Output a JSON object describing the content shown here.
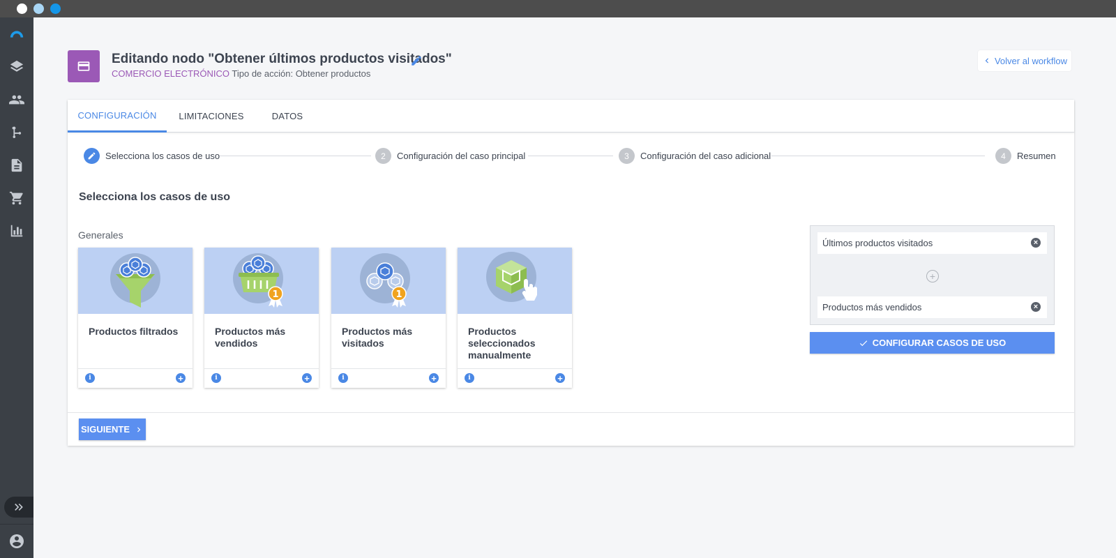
{
  "window": {
    "controls": [
      "close",
      "minimize",
      "maximize"
    ]
  },
  "sidebar": {
    "items": [
      {
        "icon": "logo-icon"
      },
      {
        "icon": "layers-icon"
      },
      {
        "icon": "people-icon"
      },
      {
        "icon": "workflow-icon"
      },
      {
        "icon": "document-icon"
      },
      {
        "icon": "cart-icon"
      },
      {
        "icon": "chart-icon"
      }
    ],
    "expand_icon": "double-chevron-right-icon",
    "avatar_icon": "account-circle-icon"
  },
  "header": {
    "title": "Editando nodo \"Obtener últimos productos visitados\"",
    "category": "COMERCIO ELECTRÓNICO",
    "action_type": "Tipo de acción: Obtener productos",
    "back_label": "Volver al workflow",
    "node_color": "#9b59b6"
  },
  "tabs": [
    {
      "label": "CONFIGURACIÓN",
      "active": true
    },
    {
      "label": "LIMITACIONES",
      "active": false
    },
    {
      "label": "DATOS",
      "active": false
    }
  ],
  "steps": [
    {
      "number": "1",
      "label": "Selecciona los casos de uso",
      "done": true
    },
    {
      "number": "2",
      "label": "Configuración del caso principal",
      "done": false
    },
    {
      "number": "3",
      "label": "Configuración del caso adicional",
      "done": false
    },
    {
      "number": "4",
      "label": "Resumen",
      "done": false
    }
  ],
  "section_title": "Selecciona los casos de uso",
  "group_title": "Generales",
  "use_cases": [
    {
      "title": "Productos filtrados",
      "illustration": "funnel-boxes"
    },
    {
      "title": "Productos más vendidos",
      "illustration": "basket-badge"
    },
    {
      "title": "Productos más visitados",
      "illustration": "boxes-badge"
    },
    {
      "title": "Productos seleccionados manualmente",
      "illustration": "box-hand"
    }
  ],
  "selected": {
    "items": [
      "Últimos productos visitados",
      "Productos más vendidos"
    ],
    "configure_label": "CONFIGURAR CASOS DE USO"
  },
  "footer": {
    "next_label": "SIGUIENTE"
  },
  "colors": {
    "accent": "#4a88e5",
    "button": "#5b8ff0",
    "sidebar": "#3b4046",
    "card_image_bg": "#bcd0f3"
  }
}
